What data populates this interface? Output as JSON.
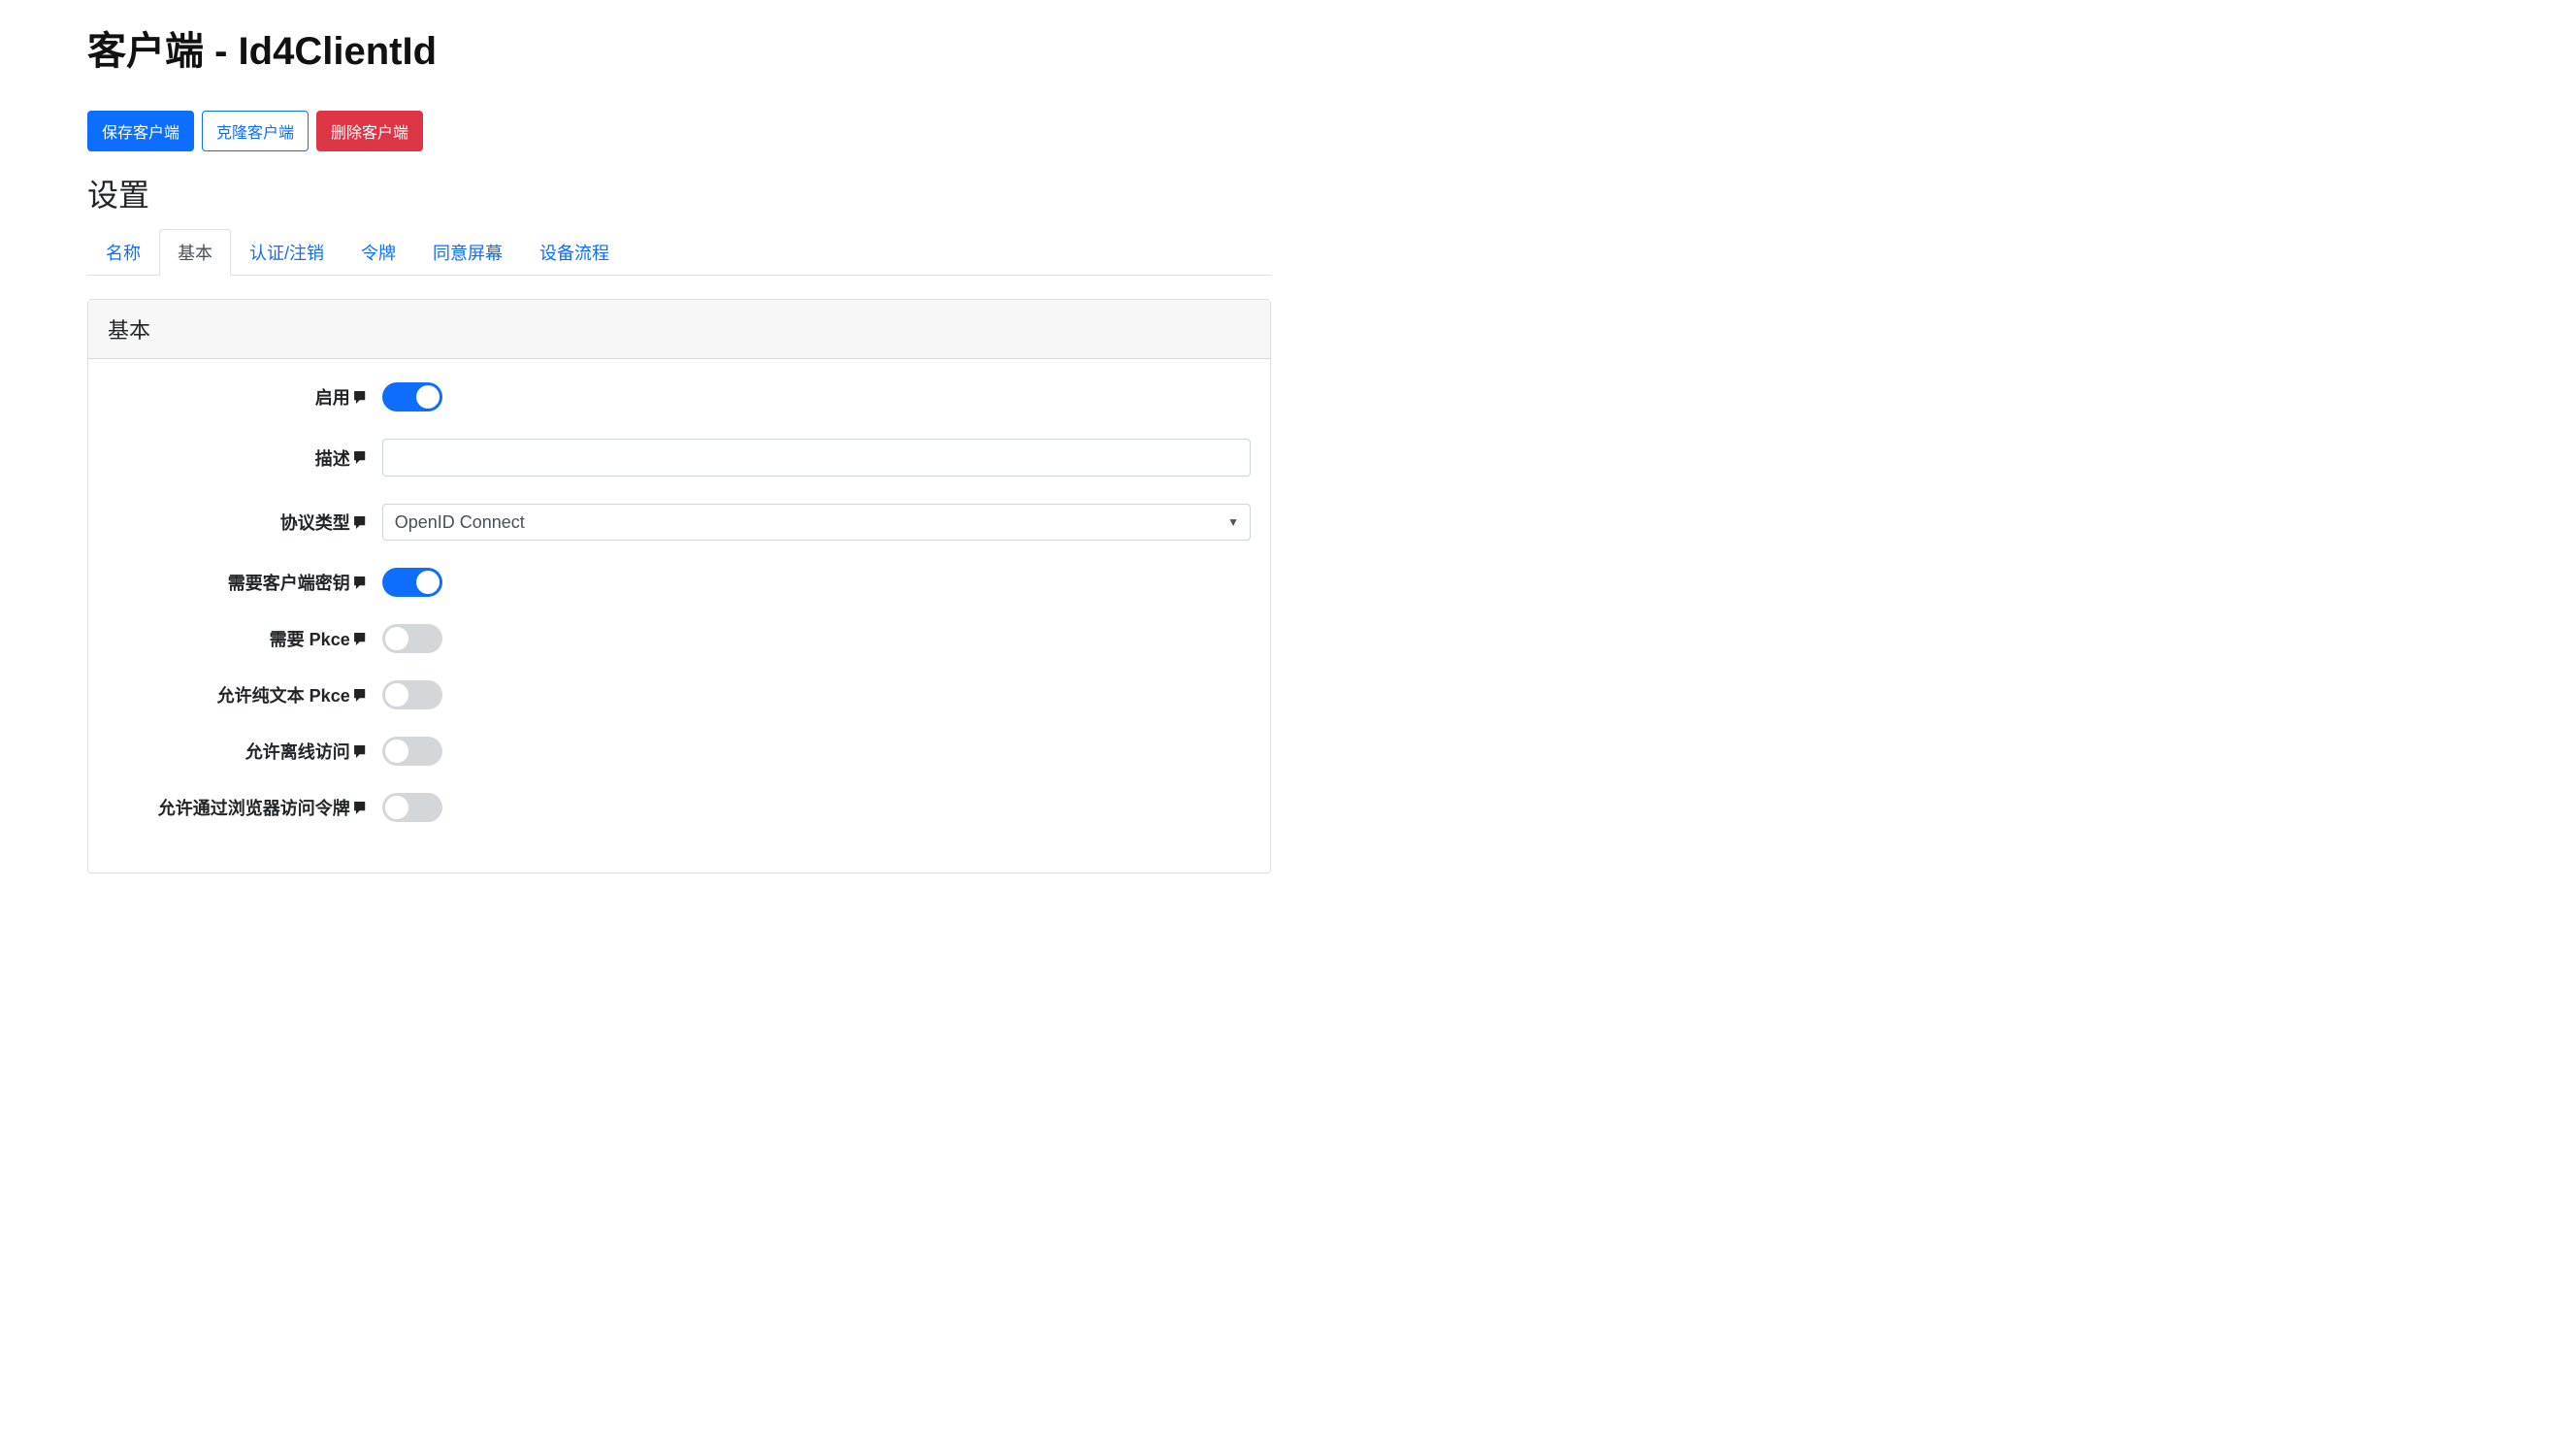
{
  "page": {
    "title": "客户端 - Id4ClientId"
  },
  "actions": {
    "save": "保存客户端",
    "clone": "克隆客户端",
    "delete": "删除客户端"
  },
  "settings_heading": "设置",
  "tabs": {
    "name": "名称",
    "basic": "基本",
    "auth": "认证/注销",
    "token": "令牌",
    "consent": "同意屏幕",
    "device": "设备流程"
  },
  "card": {
    "header": "基本"
  },
  "fields": {
    "enabled": {
      "label": "启用",
      "value": true
    },
    "description": {
      "label": "描述",
      "value": ""
    },
    "protocol_type": {
      "label": "协议类型",
      "value": "OpenID Connect"
    },
    "require_client_secret": {
      "label": "需要客户端密钥",
      "value": true
    },
    "require_pkce": {
      "label": "需要 Pkce",
      "value": false
    },
    "allow_plain_text_pkce": {
      "label": "允许纯文本 Pkce",
      "value": false
    },
    "allow_offline_access": {
      "label": "允许离线访问",
      "value": false
    },
    "allow_access_token_via_browser": {
      "label": "允许通过浏览器访问令牌",
      "value": false
    }
  }
}
